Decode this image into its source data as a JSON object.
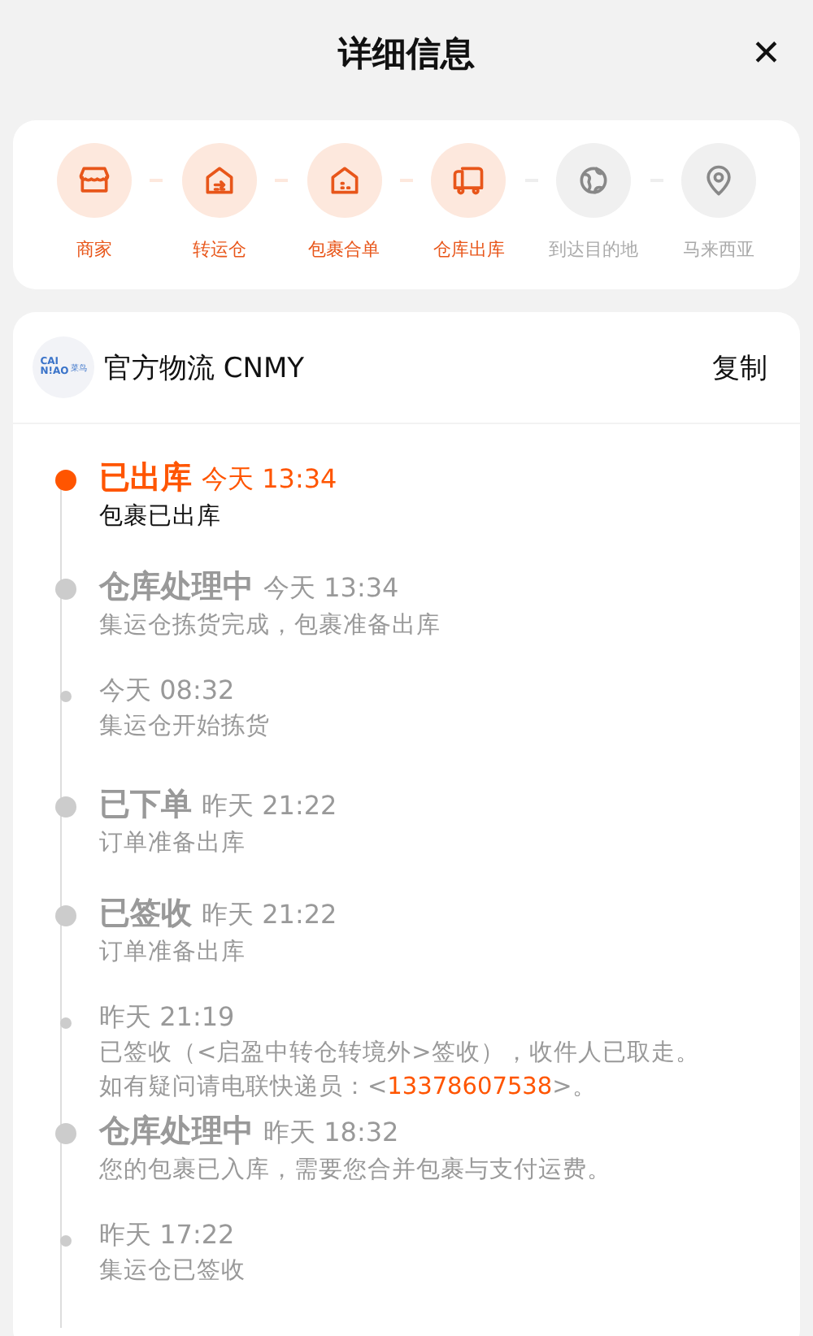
{
  "header": {
    "title": "详细信息",
    "close": "✕"
  },
  "steps": [
    {
      "label": "商家",
      "reached": true
    },
    {
      "label": "转运仓",
      "reached": true
    },
    {
      "label": "包裹合单",
      "reached": true
    },
    {
      "label": "仓库出库",
      "reached": true
    },
    {
      "label": "到达目的地",
      "reached": false
    },
    {
      "label": "马来西亚",
      "reached": false
    }
  ],
  "carrier": {
    "logo_lines": [
      "CAI",
      "N!AO"
    ],
    "logo_mark": "菜鸟",
    "tracking": "官方物流 CNMY",
    "copy": "复制"
  },
  "events": [
    {
      "status": "已出库",
      "time": "今天 13:34",
      "description": "包裹已出库",
      "current": true,
      "major": true
    },
    {
      "status": "仓库处理中",
      "time": "今天 13:34",
      "description": "集运仓拣货完成，包裹准备出库",
      "current": false,
      "major": true
    },
    {
      "time": "今天 08:32",
      "description": "集运仓开始拣货",
      "current": false,
      "major": false
    },
    {
      "status": "已下单",
      "time": "昨天 21:22",
      "description": "订单准备出库",
      "current": false,
      "major": true
    },
    {
      "status": "已签收",
      "time": "昨天 21:22",
      "description": "订单准备出库",
      "current": false,
      "major": true
    },
    {
      "time": "昨天 21:19",
      "description": "已签收（<启盈中转仓转境外>签收），收件人已取走。",
      "contact": {
        "prefix": "如有疑问请电联快递员：<",
        "phone": "13378607538",
        "suffix": ">。"
      },
      "current": false,
      "major": false
    },
    {
      "status": "仓库处理中",
      "time": "昨天 18:32",
      "description": "您的包裹已入库，需要您合并包裹与支付运费。",
      "current": false,
      "major": true
    },
    {
      "time": "昨天 17:22",
      "description": "集运仓已签收",
      "current": false,
      "major": false
    }
  ]
}
